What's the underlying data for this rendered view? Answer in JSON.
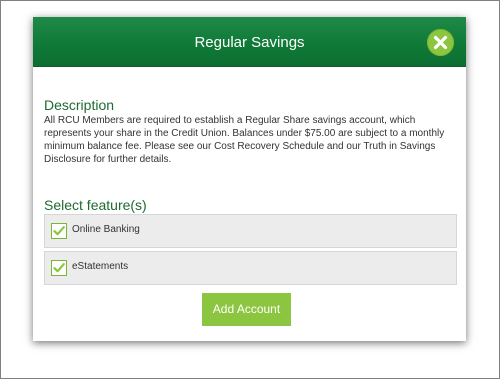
{
  "modal": {
    "title": "Regular Savings",
    "close_icon": "close-x-icon"
  },
  "description": {
    "heading": "Description",
    "text": "All RCU Members are required to establish a Regular Share savings account, which represents your share in the Credit Union. Balances under $75.00 are subject to a monthly minimum balance fee. Please see our Cost Recovery Schedule and our Truth in Savings Disclosure for further details."
  },
  "features": {
    "heading": "Select feature(s)",
    "items": [
      {
        "label": "Online Banking",
        "checked": true
      },
      {
        "label": "eStatements",
        "checked": true
      }
    ]
  },
  "actions": {
    "add_label": "Add Account"
  },
  "colors": {
    "header_green": "#107a38",
    "accent_green": "#8cc540",
    "heading_green": "#1e6b2f"
  }
}
